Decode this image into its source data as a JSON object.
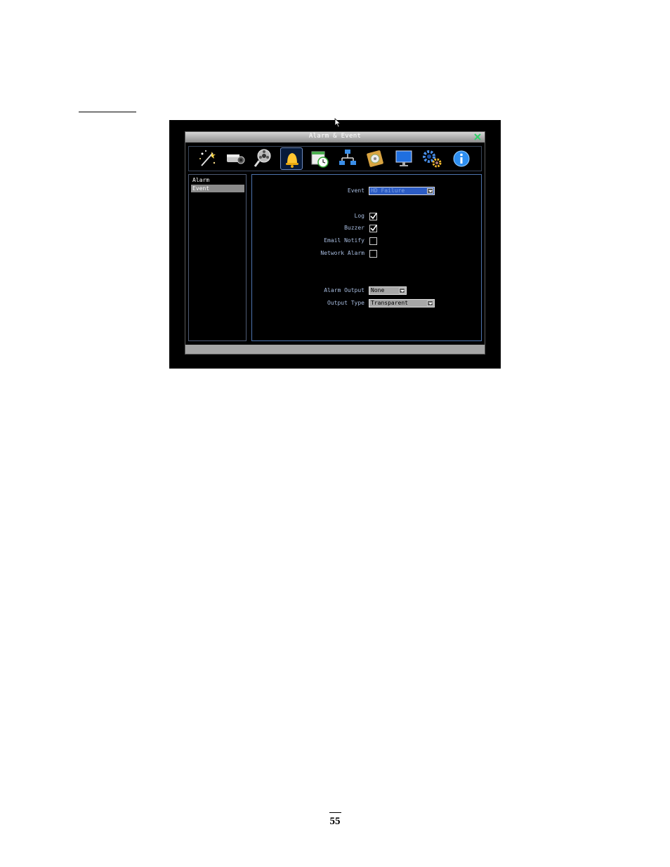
{
  "window": {
    "title": "Alarm & Event"
  },
  "toolbar": {
    "icons": [
      "wizard-icon",
      "camera-icon",
      "record-icon",
      "bell-icon",
      "schedule-icon",
      "network-icon",
      "disk-icon",
      "display-icon",
      "system-gear-icon",
      "info-icon"
    ],
    "active": "bell-icon"
  },
  "sidebar": {
    "items": [
      {
        "label": "Alarm",
        "selected": false
      },
      {
        "label": "Event",
        "selected": true
      }
    ]
  },
  "form": {
    "event_label": "Event",
    "event_value": "HD Failure",
    "log_label": "Log",
    "log_checked": true,
    "buzzer_label": "Buzzer",
    "buzzer_checked": true,
    "email_label": "Email Notify",
    "email_checked": false,
    "network_label": "Network Alarm",
    "network_checked": false,
    "alarm_output_label": "Alarm Output",
    "alarm_output_value": "None",
    "output_type_label": "Output Type",
    "output_type_value": "Transparent"
  },
  "page": {
    "number": "55"
  },
  "colors": {
    "accent": "#2c5cc4",
    "label": "#a8bde0",
    "panel_border": "#4e74b0"
  }
}
